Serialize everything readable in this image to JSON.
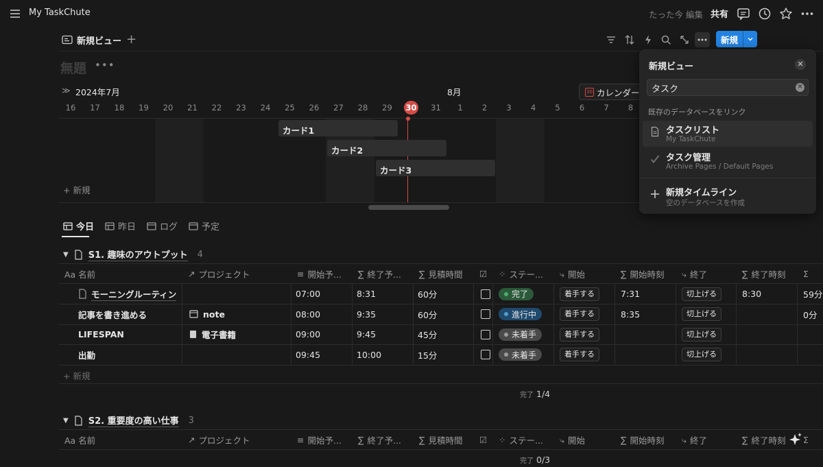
{
  "topbar": {
    "title": "My TaskChute",
    "edited": "たった今 編集",
    "share": "共有"
  },
  "view": {
    "tab_label": "新規ビュー",
    "new_button": "新規",
    "page_title": "無題"
  },
  "timeline": {
    "month_start": "2024年7月",
    "month_next": "8月",
    "calendar_button": "カレンダー",
    "days": [
      "16",
      "17",
      "18",
      "19",
      "20",
      "21",
      "22",
      "23",
      "24",
      "25",
      "26",
      "27",
      "28",
      "29",
      "30",
      "31",
      "1",
      "2",
      "3",
      "4",
      "5",
      "6",
      "7",
      "8"
    ],
    "today": "30",
    "cards": [
      {
        "label": "カード1"
      },
      {
        "label": "カード2"
      },
      {
        "label": "カード3"
      }
    ],
    "new_label": "新規"
  },
  "tabs": [
    {
      "label": "今日"
    },
    {
      "label": "昨日"
    },
    {
      "label": "ログ"
    },
    {
      "label": "予定"
    }
  ],
  "columns": [
    "Aa 名前",
    "プロジェクト",
    "開始予...",
    "終了予...",
    "見積時間",
    "",
    "ステー...",
    "開始",
    "開始時刻",
    "終了",
    "終了時刻",
    "Σ"
  ],
  "groups": [
    {
      "name": "S1. 趣味のアウトプット",
      "count": "4",
      "rows": [
        {
          "name": "モーニングルーティン",
          "project": "",
          "start": "07:00",
          "end": "8:31",
          "est": "60分",
          "status": "完了",
          "start_btn": "着手する",
          "start_time": "7:31",
          "end_btn": "切上げる",
          "end_time": "8:30",
          "extra": "59分"
        },
        {
          "name": "記事を書き進める",
          "project": "note",
          "start": "08:00",
          "end": "9:35",
          "est": "60分",
          "status": "進行中",
          "start_btn": "着手する",
          "start_time": "8:35",
          "end_btn": "切上げる",
          "end_time": "",
          "extra": "0分"
        },
        {
          "name": "LIFESPAN",
          "project": "電子書籍",
          "start": "09:00",
          "end": "9:45",
          "est": "45分",
          "status": "未着手",
          "start_btn": "着手する",
          "start_time": "",
          "end_btn": "切上げる",
          "end_time": "",
          "extra": ""
        },
        {
          "name": "出勤",
          "project": "",
          "start": "09:45",
          "end": "10:00",
          "est": "15分",
          "status": "未着手",
          "start_btn": "着手する",
          "start_time": "",
          "end_btn": "切上げる",
          "end_time": "",
          "extra": ""
        }
      ],
      "new_label": "新規",
      "summary_label": "完了",
      "summary_value": "1/4"
    },
    {
      "name": "S2. 重要度の高い仕事",
      "count": "3",
      "summary_label": "完了",
      "summary_value": "0/3"
    }
  ],
  "status_colors": {
    "完了": "#2b5a3a",
    "進行中": "#1f4a6e",
    "未着手": "#4a4a4a"
  },
  "popup": {
    "title": "新規ビュー",
    "search_value": "タスク",
    "section": "既存のデータベースをリンク",
    "items": [
      {
        "name": "タスクリスト",
        "sub": "My TaskChute",
        "icon": "page-icon"
      },
      {
        "name": "タスク管理",
        "sub": "Archive Pages / Default Pages",
        "icon": "check-icon"
      }
    ],
    "new_timeline": {
      "name": "新規タイムライン",
      "sub": "空のデータベースを作成"
    }
  }
}
